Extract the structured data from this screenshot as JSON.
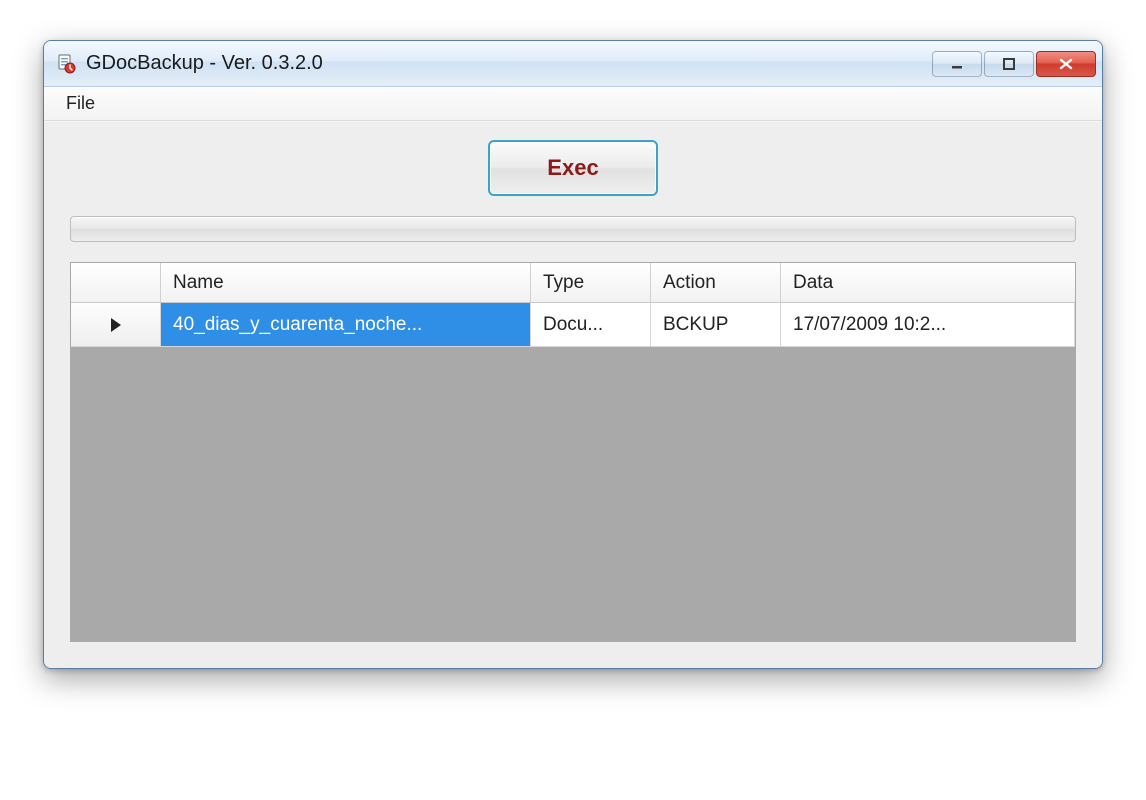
{
  "window": {
    "title": "GDocBackup - Ver. 0.3.2.0"
  },
  "menu": {
    "file": "File"
  },
  "buttons": {
    "exec": "Exec"
  },
  "grid": {
    "columns": {
      "name": "Name",
      "type": "Type",
      "action": "Action",
      "data": "Data"
    },
    "rows": [
      {
        "name": "40_dias_y_cuarenta_noche...",
        "type": "Docu...",
        "action": "BCKUP",
        "data": "17/07/2009 10:2..."
      }
    ]
  }
}
